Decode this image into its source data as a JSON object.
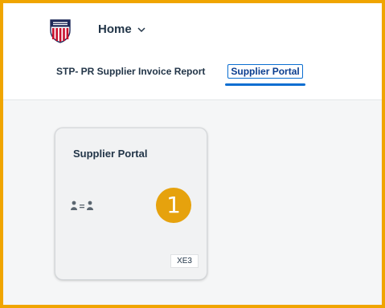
{
  "header": {
    "logo_icon": "union-pacific-shield-icon",
    "home_label": "Home",
    "home_chevron_icon": "chevron-down-icon"
  },
  "tabs": [
    {
      "label": "STP- PR Supplier Invoice Report",
      "selected": false
    },
    {
      "label": "Supplier Portal",
      "selected": true
    }
  ],
  "tile": {
    "title": "Supplier Portal",
    "icon": "supplier-exchange-icon",
    "badge": "XE3"
  },
  "callout": {
    "number": "1"
  },
  "colors": {
    "frame_border": "#f0a500",
    "callout_bg": "#e6a20d",
    "accent": "#0a6ed1",
    "text": "#223548",
    "content_bg": "#f5f6f7"
  }
}
